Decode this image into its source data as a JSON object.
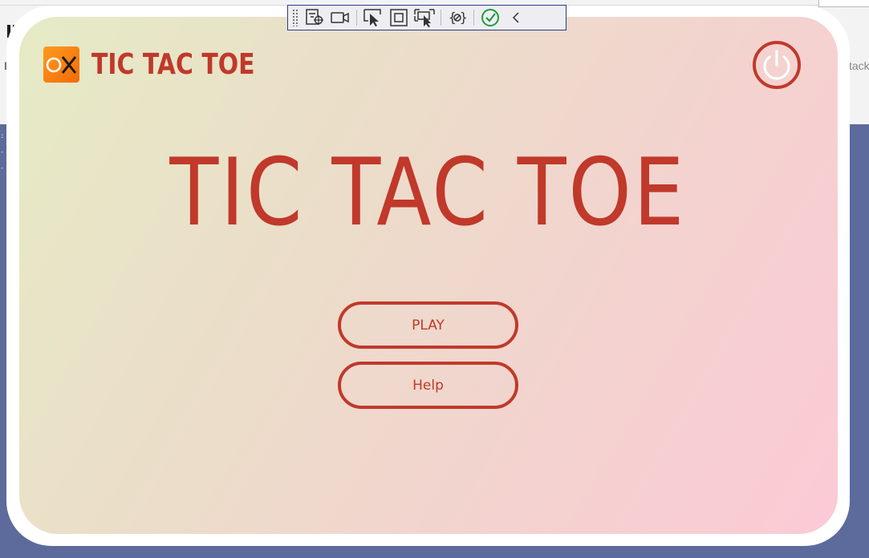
{
  "ide": {
    "right_text": "tack",
    "left_letter": "I"
  },
  "debug_toolbar": {
    "tools": [
      {
        "name": "live-visual-tree-icon"
      },
      {
        "name": "record-icon"
      },
      {
        "name": "select-element-icon"
      },
      {
        "name": "display-layout-adorners-icon"
      },
      {
        "name": "track-focus-icon"
      },
      {
        "name": "binding-failures-icon"
      },
      {
        "name": "accessibility-check-icon"
      },
      {
        "name": "collapse-chevron-icon"
      }
    ]
  },
  "app": {
    "logo_icon": "ox-logo-icon",
    "title": "TIC TAC TOE",
    "power_icon": "power-icon",
    "hero_title": "TIC TAC TOE",
    "buttons": {
      "play": "PLAY",
      "help": "Help"
    }
  },
  "colors": {
    "accent": "#c0392b",
    "logo_orange": "#f57c0f",
    "ide_blue": "#5c6b9b",
    "toolbar_check_green": "#1e9c3a"
  }
}
